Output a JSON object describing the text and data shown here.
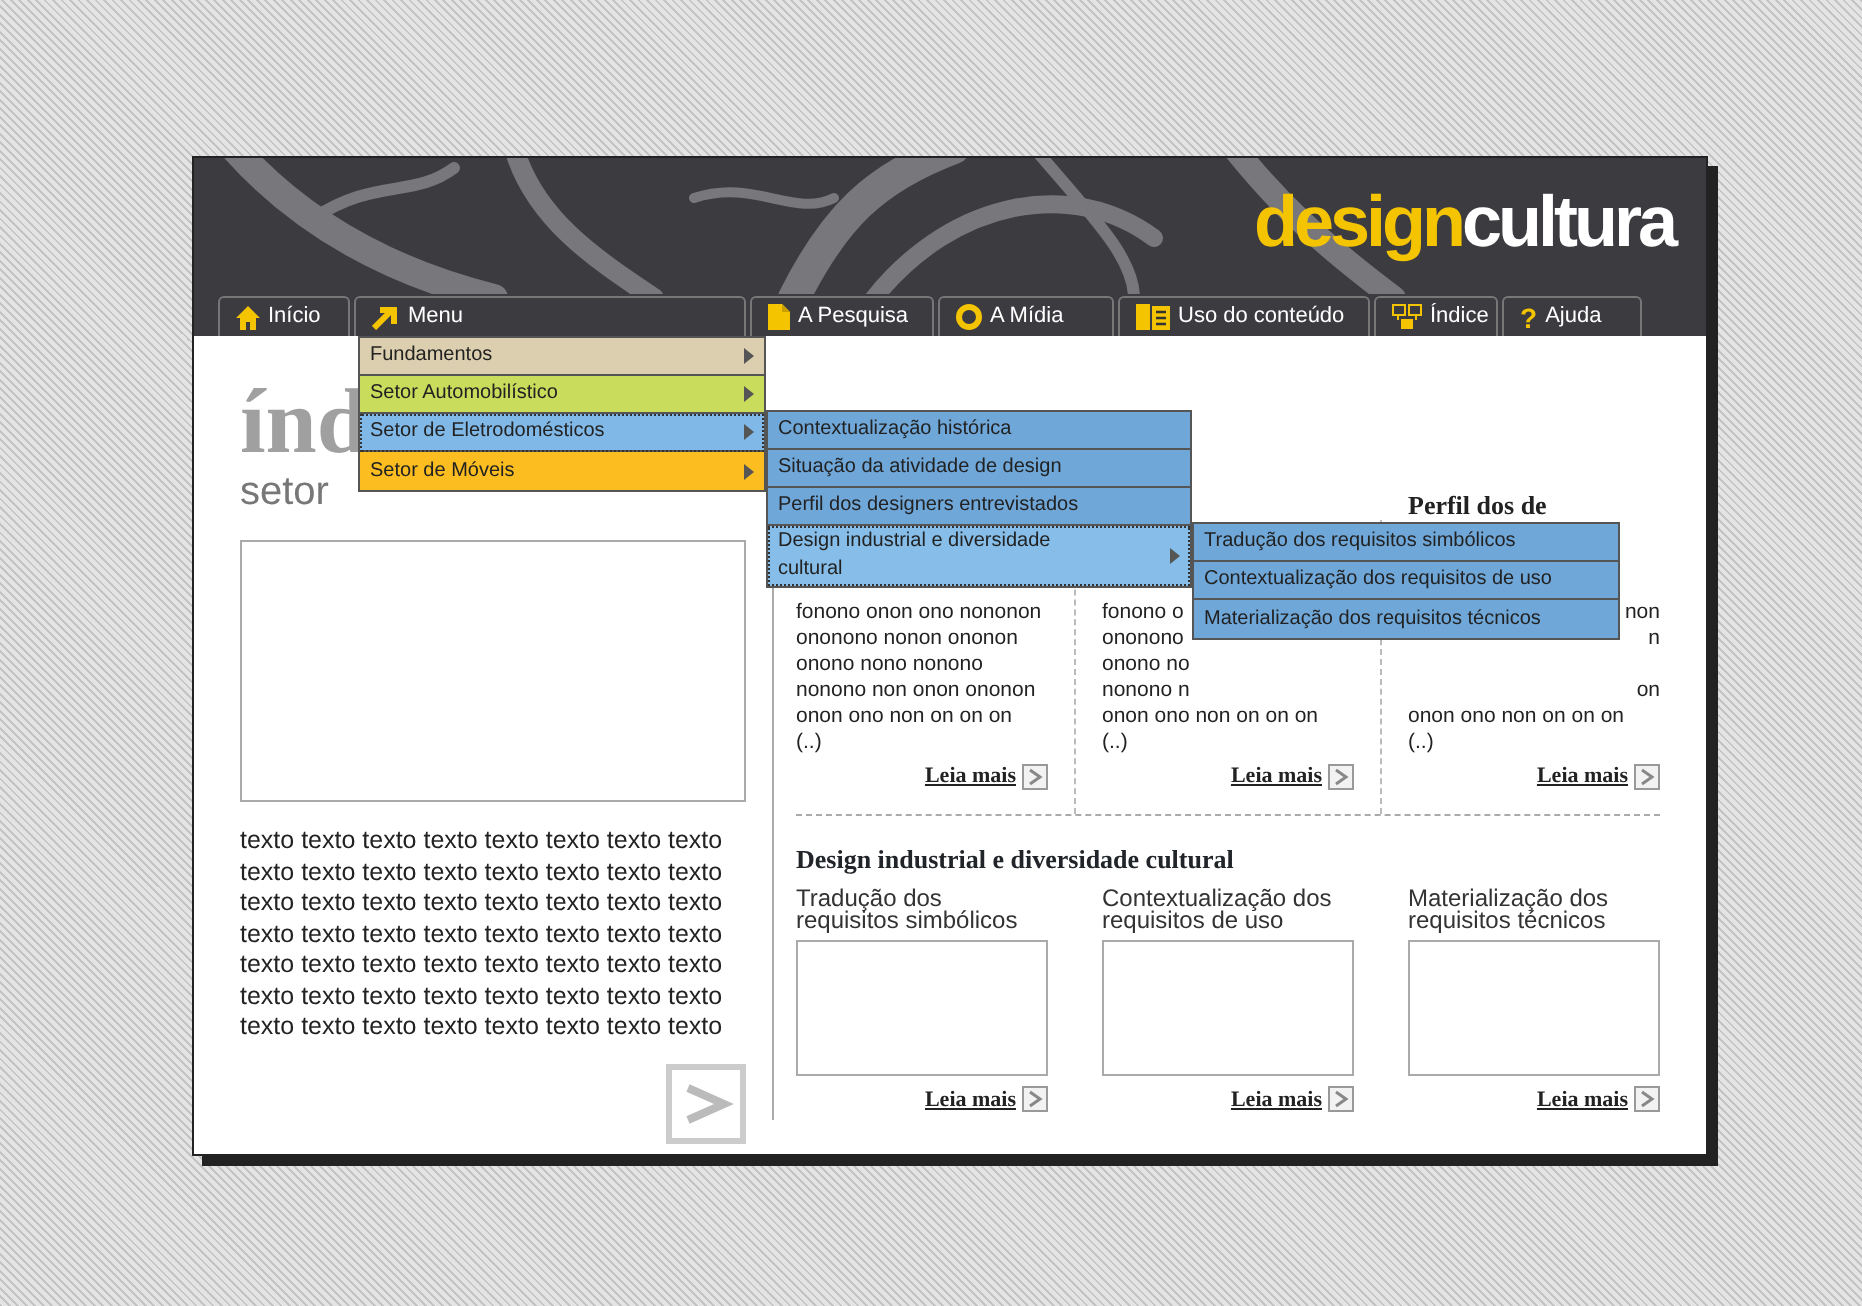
{
  "logo": {
    "part_1": "design",
    "part_2": "cultura"
  },
  "tabs": [
    {
      "label": "Início"
    },
    {
      "label": "Menu"
    },
    {
      "label": "A Pesquisa"
    },
    {
      "label": "A Mídia"
    },
    {
      "label": "Uso do conteúdo"
    },
    {
      "label": "Índice"
    },
    {
      "label": "Ajuda",
      "glyph": "?"
    }
  ],
  "page": {
    "title": "índ",
    "subtitle": "setor",
    "body": "texto texto texto texto texto texto texto texto texto texto texto texto texto texto texto texto texto texto texto texto texto texto texto texto texto texto texto texto texto texto texto texto texto texto texto texto texto texto texto texto texto texto texto texto texto texto texto texto texto texto texto texto texto texto texto texto"
  },
  "top_columns": [
    {
      "lines": [
        {
          "text": "fonono onon ono nononon"
        },
        {
          "text": "ononono nonon ononon"
        },
        {
          "text": "onono nono nonono"
        },
        {
          "text": "nonono non onon ononon"
        },
        {
          "text": "onon ono non on on on"
        },
        {
          "text": "(..)"
        }
      ],
      "link": "Leia mais"
    },
    {
      "lines": [
        {
          "text": "fonono o"
        },
        {
          "text": "ononono"
        },
        {
          "text": "onono no"
        },
        {
          "text": "nonono n"
        },
        {
          "text": "onon ono non on on on"
        },
        {
          "text": "(..)"
        }
      ],
      "link": "Leia mais"
    },
    {
      "heading": "Perfil dos de",
      "lines": [
        {
          "text": "non",
          "covered": true
        },
        {
          "text": "n",
          "covered": true
        },
        {
          "covered": true
        },
        {
          "text": "on",
          "covered": true
        },
        {
          "text": "onon ono non on on on"
        },
        {
          "text": "(..)"
        }
      ],
      "link": "Leia mais"
    }
  ],
  "section": {
    "title": "Design industrial e diversidade cultural",
    "items": [
      {
        "label": "Tradução dos requisitos simbólicos",
        "link": "Leia mais"
      },
      {
        "label": "Contextualização dos requisitos de uso",
        "link": "Leia mais"
      },
      {
        "label": "Materialização dos requisitos técnicos",
        "link": "Leia mais"
      }
    ]
  },
  "menu": [
    {
      "label": "Fundamentos",
      "color": "#dccfb0",
      "selected": false,
      "has_submenu": true
    },
    {
      "label": "Setor Automobilístico",
      "color": "#c9dc5c",
      "selected": false,
      "has_submenu": true
    },
    {
      "label": "Setor de Eletrodomésticos",
      "color": "#80b9e8",
      "selected": true,
      "has_submenu": true,
      "children": [
        {
          "label": "Contextualização histórica",
          "selected": false,
          "has_submenu": false
        },
        {
          "label": "Situação da atividade de design",
          "selected": false,
          "has_submenu": false
        },
        {
          "label": "Perfil dos designers entrevistados",
          "selected": false,
          "has_submenu": false
        },
        {
          "label": "Design industrial e diversidade cultural",
          "selected": true,
          "has_submenu": true,
          "children": [
            {
              "label": "Tradução dos requisitos simbólicos",
              "selected": false,
              "has_submenu": false
            },
            {
              "label": "Contextualização dos requisitos de uso",
              "selected": false,
              "has_submenu": false
            },
            {
              "label": "Materialização dos requisitos técnicos",
              "selected": false,
              "has_submenu": false
            }
          ]
        }
      ]
    },
    {
      "label": "Setor de Móveis",
      "color": "#fbbd20",
      "selected": false,
      "has_submenu": true
    }
  ]
}
